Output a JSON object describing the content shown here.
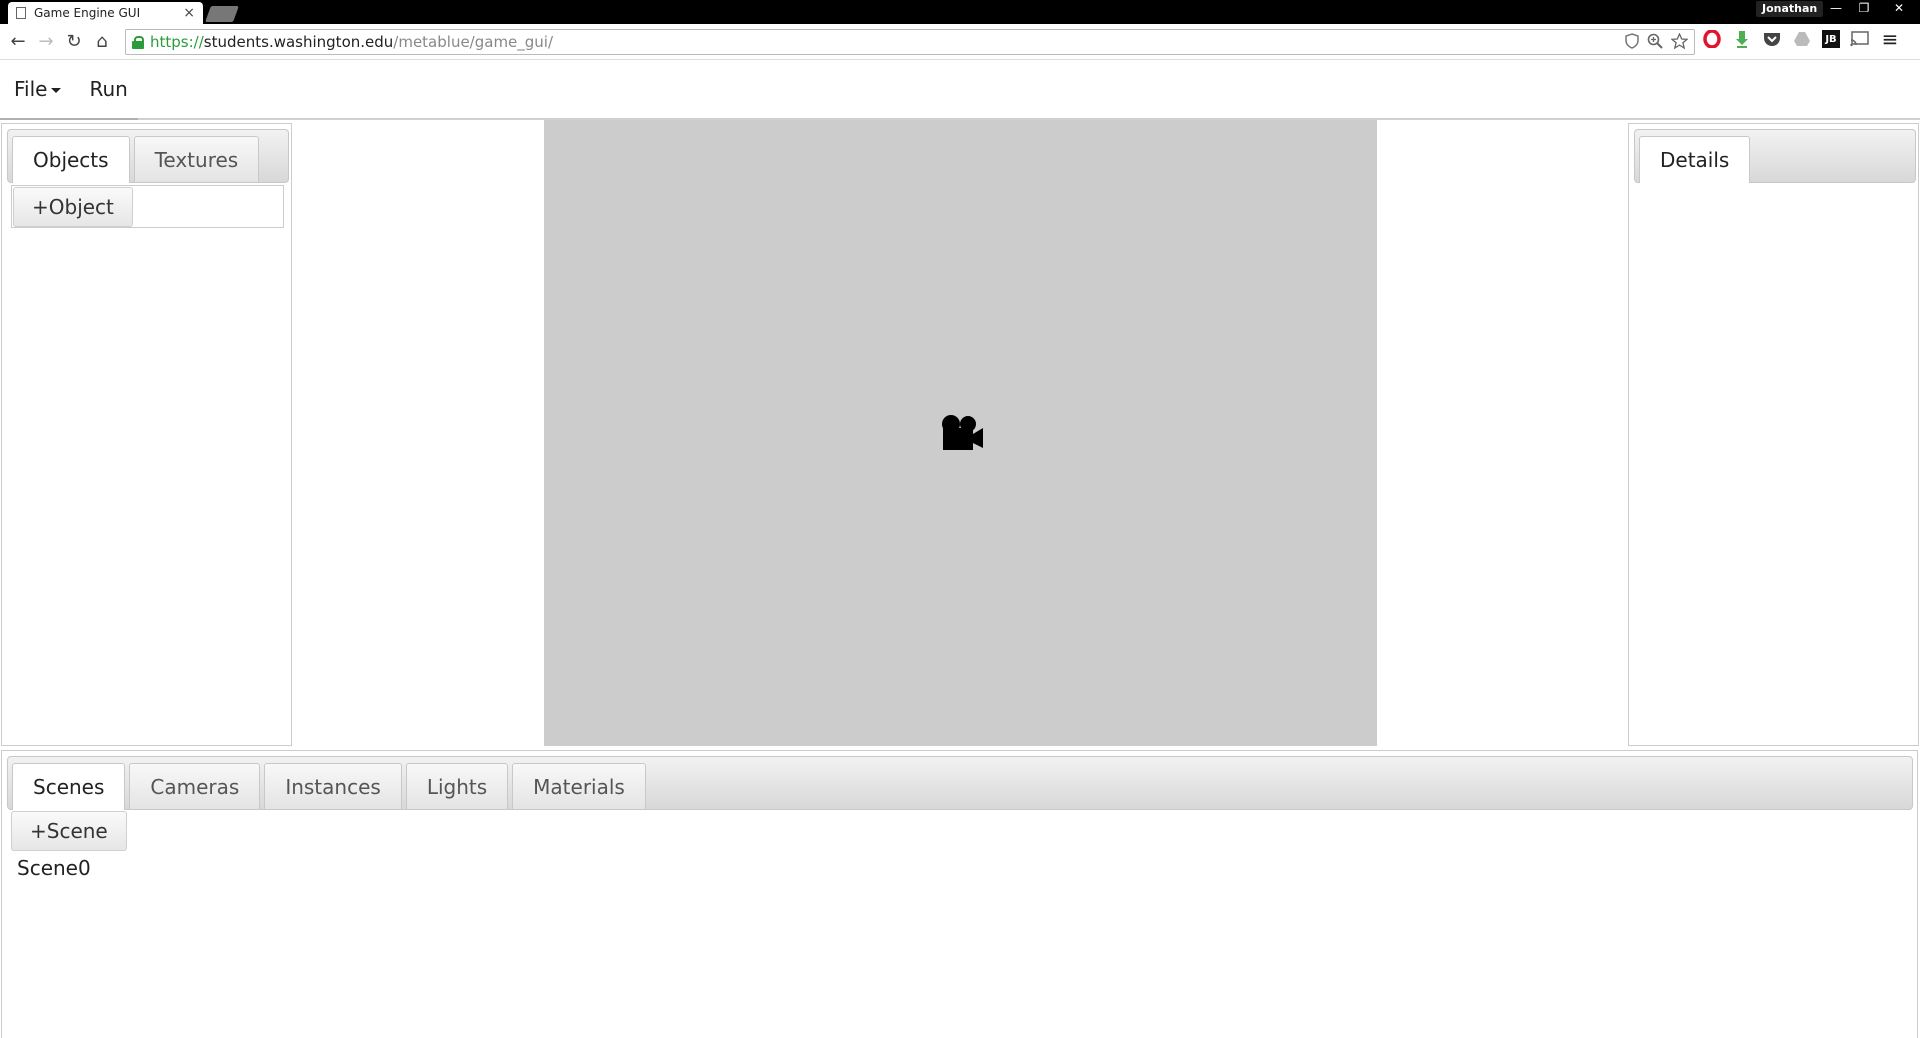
{
  "browser": {
    "tab_title": "Game Engine GUI",
    "tab_close": "×",
    "profile_name": "Jonathan",
    "window_controls": {
      "minimize": "—",
      "restore": "❐",
      "close": "✕"
    },
    "nav": {
      "back": "←",
      "forward": "→",
      "reload": "↻",
      "home": "⌂"
    },
    "url": {
      "scheme": "https://",
      "host": "students.washington.edu",
      "path": "/metablue/game_gui/"
    },
    "omnibox_icons": [
      "shield-icon",
      "zoom-icon",
      "star-icon"
    ],
    "extensions": [
      "opera-icon",
      "download-icon",
      "pocket-icon",
      "drive-icon",
      "jb-icon",
      "cast-icon",
      "menu-icon"
    ],
    "menu_glyph": "≡",
    "ext_jb_label": "JB"
  },
  "menubar": {
    "file": "File",
    "run": "Run"
  },
  "left_panel": {
    "tabs": [
      {
        "label": "Objects",
        "active": true
      },
      {
        "label": "Textures",
        "active": false
      }
    ],
    "add_button": "+Object"
  },
  "right_panel": {
    "tabs": [
      {
        "label": "Details",
        "active": true
      }
    ]
  },
  "bottom_panel": {
    "tabs": [
      {
        "label": "Scenes",
        "active": true
      },
      {
        "label": "Cameras",
        "active": false
      },
      {
        "label": "Instances",
        "active": false
      },
      {
        "label": "Lights",
        "active": false
      },
      {
        "label": "Materials",
        "active": false
      }
    ],
    "add_button": "+Scene",
    "scenes": [
      "Scene0"
    ]
  },
  "viewport": {
    "background": "#cccccc",
    "objects": [
      "camera-icon"
    ]
  },
  "colors": {
    "secure_green": "#2a9d3a",
    "opera_red": "#e0142d",
    "download_green": "#4caf50"
  }
}
